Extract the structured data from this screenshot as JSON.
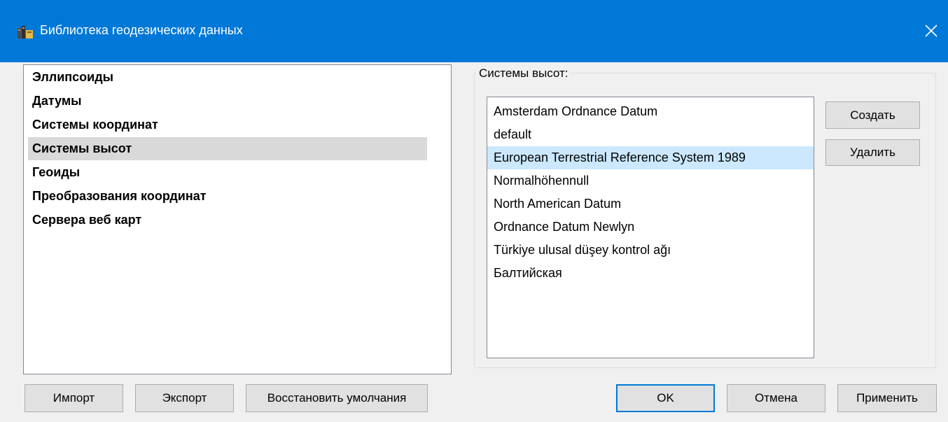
{
  "window": {
    "title": "Библиотека геодезических данных",
    "accent": "#0078d7",
    "app_icon": "books-icon",
    "close_icon": "close-icon"
  },
  "nav": {
    "items": [
      "Эллипсоиды",
      "Датумы",
      "Системы координат",
      "Системы высот",
      "Геоиды",
      "Преобразования координат",
      "Сервера веб карт"
    ],
    "selected": "Системы высот"
  },
  "heights_group": {
    "title": "Системы высот:",
    "items": [
      "Amsterdam Ordnance Datum",
      "default",
      "European Terrestrial Reference System 1989",
      "Normalhöhennull",
      "North American Datum",
      "Ordnance Datum Newlyn",
      "Türkiye ulusal düşey kontrol ağı",
      "Балтийская"
    ],
    "selected": "European Terrestrial Reference System 1989",
    "create_label": "Создать",
    "delete_label": "Удалить"
  },
  "footer": {
    "import_label": "Импорт",
    "export_label": "Экспорт",
    "restore_label": "Восстановить умолчания",
    "ok_label": "OK",
    "cancel_label": "Отмена",
    "apply_label": "Применить"
  }
}
